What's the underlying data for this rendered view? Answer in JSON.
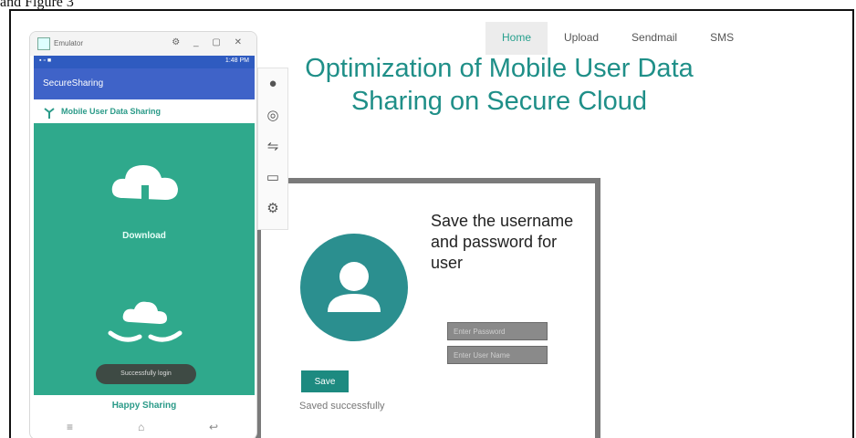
{
  "caption": "and Figure 3",
  "nav": {
    "items": [
      "Home",
      "Upload",
      "Sendmail",
      "SMS"
    ],
    "active": "Home"
  },
  "title": "Optimization of Mobile User Data Sharing on Secure Cloud",
  "card": {
    "heading": "Save the username and password for user",
    "password_field": "Enter Password",
    "username_field": "Enter User Name",
    "save_label": "Save",
    "status": "Saved successfully"
  },
  "phone": {
    "emulator_title": "Emulator",
    "status_time": "1:48 PM",
    "app_title": "SecureSharing",
    "header": "Mobile User Data Sharing",
    "download_label": "Download",
    "toast": "Successfully login",
    "footer": "Happy Sharing",
    "accent": "#2fa98c",
    "appbar_color": "#3f63c8"
  },
  "side_toolbar": [
    "avatar-icon",
    "camera-icon",
    "settings-icon",
    "folder-icon",
    "gear-icon"
  ]
}
